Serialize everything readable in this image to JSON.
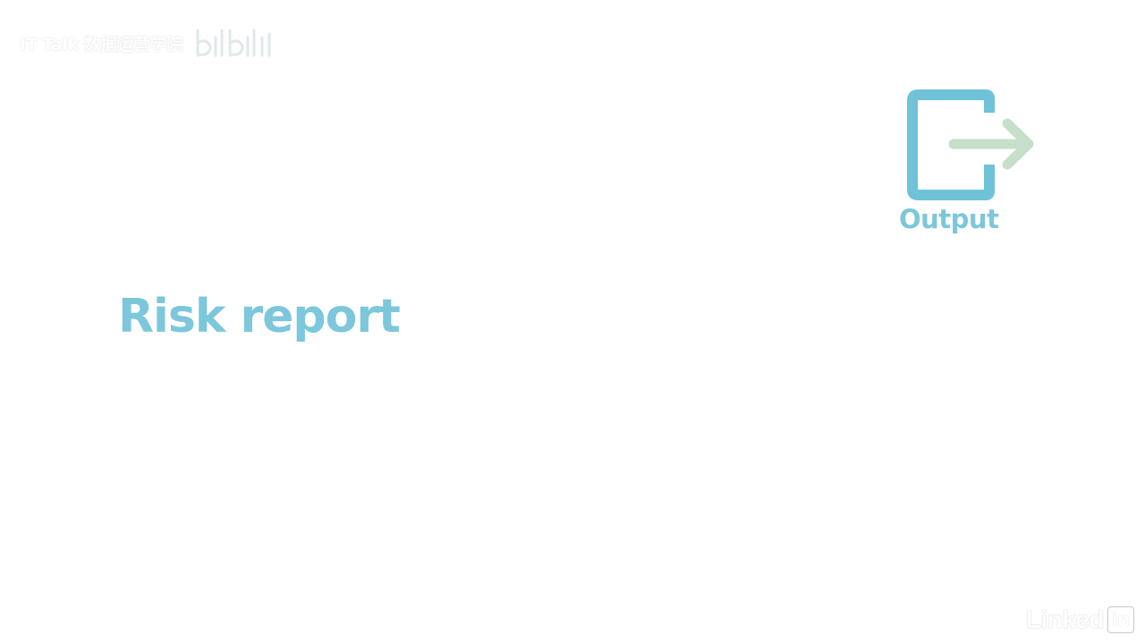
{
  "watermark": {
    "text": "IT Talk 数据运营学院"
  },
  "output": {
    "label": "Output"
  },
  "slide": {
    "title": "Risk report"
  },
  "brand": {
    "word": "Linked",
    "box": "in"
  },
  "colors": {
    "accent_blue": "#7cc7db",
    "icon_box": "#6fc2d8",
    "arrow_green": "#c5dfc9"
  },
  "icons": {
    "output": "exit-box-arrow-icon"
  }
}
